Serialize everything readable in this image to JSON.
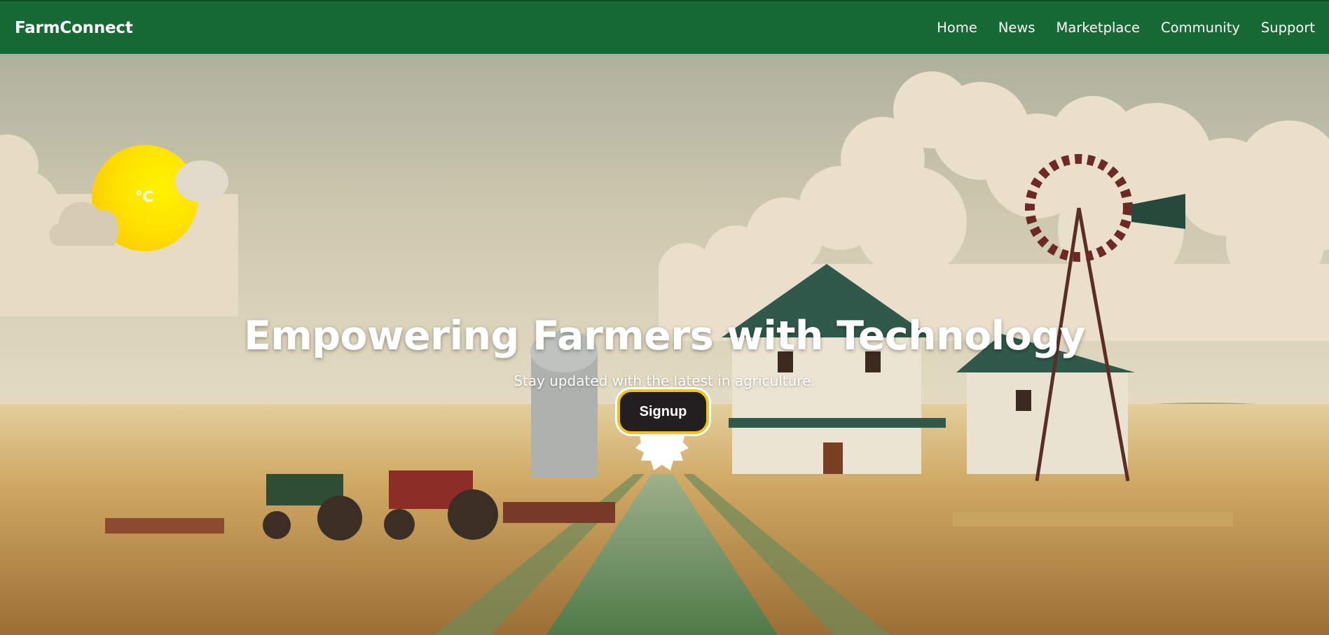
{
  "nav": {
    "brand": "FarmConnect",
    "links": [
      "Home",
      "News",
      "Marketplace",
      "Community",
      "Support"
    ]
  },
  "weather": {
    "temperature": "°C",
    "icon": "sun-behind-clouds-icon"
  },
  "hero": {
    "title": "Empowering Farmers with Technology",
    "subtitle": "Stay updated with the latest in agriculture.",
    "cta_label": "Signup"
  },
  "colors": {
    "nav_bg": "#176a36",
    "cta_bg": "#231f20",
    "cta_border": "#f2c11c",
    "sun": "#ffe200"
  }
}
